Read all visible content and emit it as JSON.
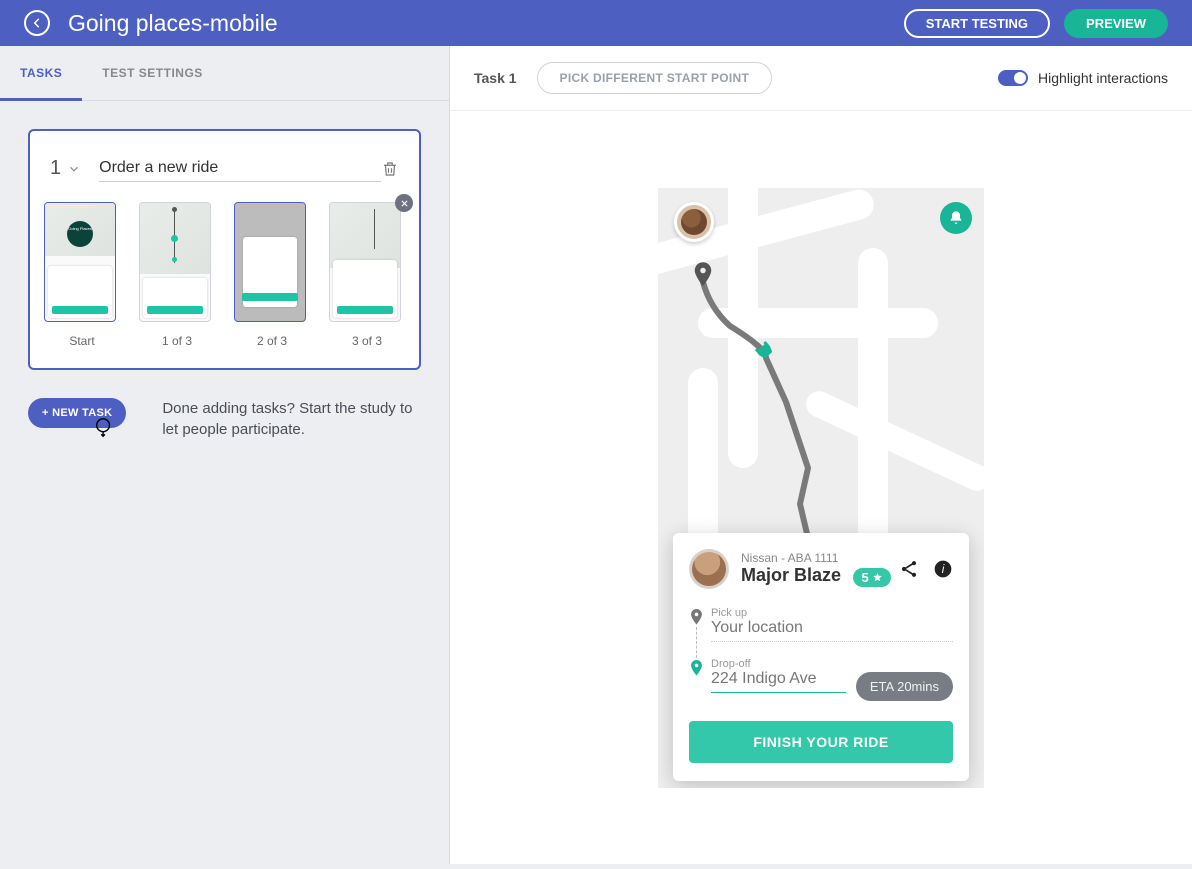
{
  "header": {
    "title": "Going places-mobile",
    "start_testing": "START TESTING",
    "preview": "PREVIEW"
  },
  "sidebar": {
    "tabs": {
      "tasks": "TASKS",
      "settings": "TEST SETTINGS"
    },
    "task": {
      "number": "1",
      "title": "Order a new ride",
      "thumbs": {
        "start": "Start",
        "t1": "1 of 3",
        "t2": "2 of 3",
        "t3": "3 of 3"
      }
    },
    "new_task": "+ NEW TASK",
    "help_text": "Done adding tasks? Start the study to let people participate."
  },
  "preview": {
    "task_label": "Task 1",
    "pick_btn": "PICK DIFFERENT START POINT",
    "toggle_label": "Highlight interactions"
  },
  "phone": {
    "driver": {
      "car": "Nissan - ABA 1111",
      "name": "Major Blaze",
      "rating": "5"
    },
    "pickup_label": "Pick up",
    "pickup_value": "Your location",
    "dropoff_label": "Drop-off",
    "dropoff_value": "224 Indigo Ave",
    "eta": "ETA 20mins",
    "finish": "FINISH YOUR RIDE",
    "thumb_badge": "Going Places"
  }
}
